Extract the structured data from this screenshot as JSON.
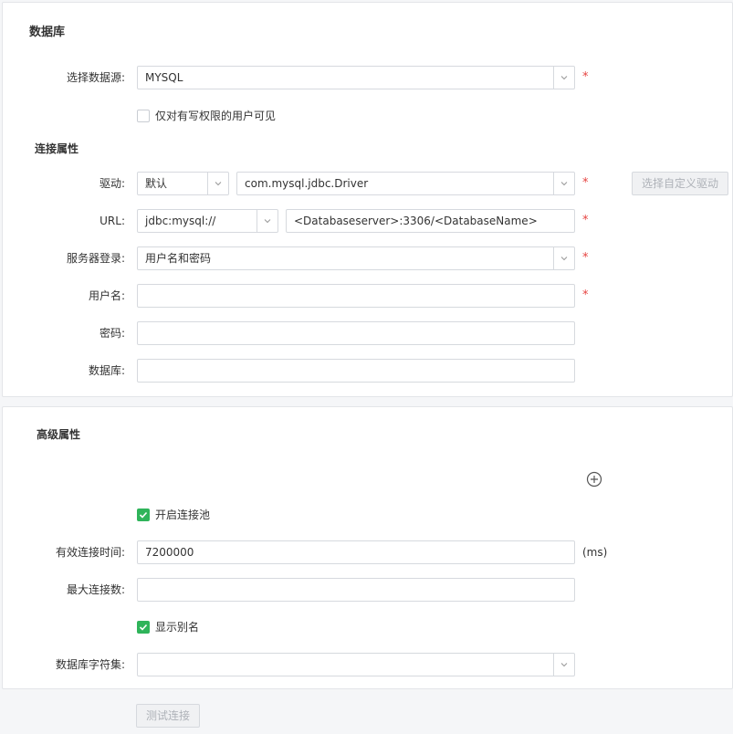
{
  "database_section": {
    "title": "数据库",
    "datasource": {
      "label": "选择数据源:",
      "value": "MYSQL",
      "required": "*"
    },
    "write_only_checkbox": {
      "label": "仅对有写权限的用户可见",
      "checked": false
    }
  },
  "connection_section": {
    "title": "连接属性",
    "driver": {
      "label": "驱动:",
      "mode_value": "默认",
      "class_value": "com.mysql.jdbc.Driver",
      "required": "*",
      "custom_button": "选择自定义驱动"
    },
    "url": {
      "label": "URL:",
      "prefix_value": "jdbc:mysql://",
      "value": "<Databaseserver>:3306/<DatabaseName>",
      "required": "*"
    },
    "server_login": {
      "label": "服务器登录:",
      "value": "用户名和密码",
      "required": "*"
    },
    "username": {
      "label": "用户名:",
      "value": "",
      "required": "*"
    },
    "password": {
      "label": "密码:",
      "value": ""
    },
    "database": {
      "label": "数据库:",
      "value": ""
    }
  },
  "advanced_section": {
    "title": "高级属性",
    "add_icon": "plus-circle-icon",
    "pool_checkbox": {
      "label": "开启连接池",
      "checked": true
    },
    "valid_time": {
      "label": "有效连接时间:",
      "value": "7200000",
      "unit": "(ms)"
    },
    "max_connections": {
      "label": "最大连接数:",
      "value": ""
    },
    "alias_checkbox": {
      "label": "显示别名",
      "checked": true
    },
    "charset": {
      "label": "数据库字符集:",
      "value": ""
    }
  },
  "footer": {
    "test_button": "测试连接"
  },
  "colors": {
    "required": "#e64340",
    "check_green": "#2fb45a",
    "border": "#d6d9de"
  }
}
